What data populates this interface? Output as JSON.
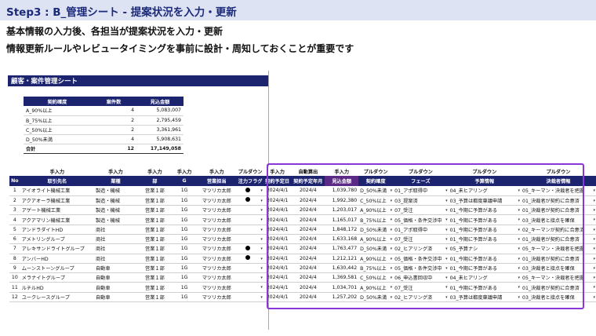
{
  "step_title": "Step3 : B_管理シート - 提案状況を入力・更新",
  "desc1": "基本情報の入力後、各担当が提案状況を入力・更新",
  "desc2": "情報更新ルールやレビュータイミングを事前に設計・周知しておくことが重要です",
  "sheet_title": "顧客・案件管理シート",
  "summary": {
    "headers": [
      "契約確度",
      "案件数",
      "見込金額"
    ],
    "rows": [
      {
        "label": "A_90%以上",
        "count": "4",
        "amount": "5,083,007"
      },
      {
        "label": "B_75%以上",
        "count": "2",
        "amount": "2,795,459"
      },
      {
        "label": "C_50%以上",
        "count": "2",
        "amount": "3,361,961"
      },
      {
        "label": "D_50%未満",
        "count": "4",
        "amount": "5,908,631"
      }
    ],
    "total": {
      "label": "合計",
      "count": "12",
      "amount": "17,149,058"
    }
  },
  "table": {
    "groups": [
      "",
      "手入力",
      "手入力",
      "手入力",
      "手入力",
      "手入力",
      "プルダウン",
      "手入力",
      "自動算出",
      "手入力",
      "プルダウン",
      "プルダウン",
      "プルダウン",
      "プルダウン"
    ],
    "headers": [
      "No",
      "取引先名",
      "業種",
      "部",
      "G",
      "営業担当",
      "注力フラグ",
      "契約予定日",
      "契約予定年月",
      "見込金額",
      "契約確度",
      "フェーズ",
      "予算情報",
      "決裁者情報"
    ],
    "rows": [
      {
        "no": "1",
        "name": "アイオライト機械工業",
        "ind": "製造・機械",
        "dept": "営業１部",
        "g": "1G",
        "rep": "マツリカ太郎",
        "flag": true,
        "date": "2024/4/1",
        "ym": "2024/4",
        "amt": "1,039,780",
        "prob": "D_50%未満",
        "phase": "01_アポ取得中",
        "budget": "04_未ヒアリング",
        "decider": "05_キーマン・決裁者を把握"
      },
      {
        "no": "2",
        "name": "アクアオーラ機械工業",
        "ind": "製造・機械",
        "dept": "営業１部",
        "g": "1G",
        "rep": "マツリカ太郎",
        "flag": true,
        "date": "2024/4/1",
        "ym": "2024/4",
        "amt": "1,992,380",
        "prob": "C_50%以上",
        "phase": "03_提案済",
        "budget": "03_予算は都度稟議申請",
        "decider": "01_決裁者が契約に合意済"
      },
      {
        "no": "3",
        "name": "アゲート機械工業",
        "ind": "製造・機械",
        "dept": "営業１部",
        "g": "1G",
        "rep": "マツリカ太郎",
        "flag": false,
        "date": "2024/4/1",
        "ym": "2024/4",
        "amt": "1,203,017",
        "prob": "A_90%以上",
        "phase": "07_受注",
        "budget": "01_今期に予算がある",
        "decider": "01_決裁者が契約に合意済"
      },
      {
        "no": "4",
        "name": "アクアマリン機械工業",
        "ind": "製造・機械",
        "dept": "営業１部",
        "g": "1G",
        "rep": "マツリカ太郎",
        "flag": false,
        "date": "2024/4/1",
        "ym": "2024/4",
        "amt": "1,165,017",
        "prob": "B_75%以上",
        "phase": "05_価格・条件交渉中",
        "budget": "01_今期に予算がある",
        "decider": "03_決裁者と接点を確保"
      },
      {
        "no": "5",
        "name": "アンドラダイトHD",
        "ind": "商社",
        "dept": "営業１部",
        "g": "1G",
        "rep": "マツリカ太郎",
        "flag": false,
        "date": "2024/4/1",
        "ym": "2024/4",
        "amt": "1,848,172",
        "prob": "D_50%未満",
        "phase": "01_アポ取得中",
        "budget": "01_今期に予算がある",
        "decider": "02_キーマンが契約に合意済"
      },
      {
        "no": "6",
        "name": "アメトリングループ",
        "ind": "商社",
        "dept": "営業１部",
        "g": "1G",
        "rep": "マツリカ太郎",
        "flag": false,
        "date": "2024/4/1",
        "ym": "2024/4",
        "amt": "1,633,168",
        "prob": "A_90%以上",
        "phase": "07_受注",
        "budget": "01_今期に予算がある",
        "decider": "01_決裁者が契約に合意済"
      },
      {
        "no": "7",
        "name": "アレキサンドライトグループ",
        "ind": "商社",
        "dept": "営業１部",
        "g": "1G",
        "rep": "マツリカ太郎",
        "flag": true,
        "date": "2024/4/1",
        "ym": "2024/4",
        "amt": "1,763,477",
        "prob": "D_50%未満",
        "phase": "02_ヒアリング済",
        "budget": "05_予算ナシ",
        "decider": "05_キーマン・決裁者を把握"
      },
      {
        "no": "8",
        "name": "アンバーHD",
        "ind": "商社",
        "dept": "営業１部",
        "g": "1G",
        "rep": "マツリカ太郎",
        "flag": true,
        "date": "2024/4/1",
        "ym": "2024/4",
        "amt": "1,212,121",
        "prob": "A_90%以上",
        "phase": "05_価格・条件交渉中",
        "budget": "01_今期に予算がある",
        "decider": "01_決裁者が契約に合意済"
      },
      {
        "no": "9",
        "name": "ムーンストーングループ",
        "ind": "自動車",
        "dept": "営業１部",
        "g": "1G",
        "rep": "マツリカ太郎",
        "flag": false,
        "date": "2024/4/1",
        "ym": "2024/4",
        "amt": "1,630,442",
        "prob": "B_75%以上",
        "phase": "05_価格・条件交渉中",
        "budget": "01_今期に予算がある",
        "decider": "03_決裁者と接点を確保"
      },
      {
        "no": "10",
        "name": "メラナイトグループ",
        "ind": "自動車",
        "dept": "営業１部",
        "g": "1G",
        "rep": "マツリカ太郎",
        "flag": false,
        "date": "2024/4/1",
        "ym": "2024/4",
        "amt": "1,369,581",
        "prob": "C_50%以上",
        "phase": "06_申込書回収中",
        "budget": "04_未ヒアリング",
        "decider": "05_キーマン・決裁者を把握"
      },
      {
        "no": "11",
        "name": "ルチルHD",
        "ind": "自動車",
        "dept": "営業１部",
        "g": "1G",
        "rep": "マツリカ太郎",
        "flag": false,
        "date": "2024/4/1",
        "ym": "2024/4",
        "amt": "1,034,701",
        "prob": "A_90%以上",
        "phase": "07_受注",
        "budget": "01_今期に予算がある",
        "decider": "01_決裁者が契約に合意済"
      },
      {
        "no": "12",
        "name": "ユークレースグループ",
        "ind": "自動車",
        "dept": "営業１部",
        "g": "1G",
        "rep": "マツリカ太郎",
        "flag": false,
        "date": "2024/4/1",
        "ym": "2024/4",
        "amt": "1,257,202",
        "prob": "D_50%未満",
        "phase": "02_ヒアリング済",
        "budget": "03_予算は都度稟議申請",
        "decider": "03_決裁者と接点を確保"
      }
    ]
  },
  "icons": {
    "dropdown": "▾"
  },
  "colors": {
    "header_navy": "#1c2470",
    "header_purple": "#5b2a86",
    "highlight_frame": "#8a36d8"
  }
}
